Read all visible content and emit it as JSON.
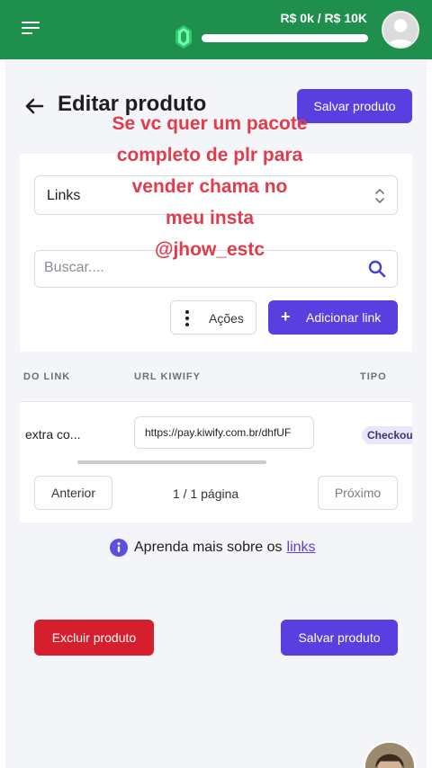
{
  "header": {
    "revenue_text": "R$ 0k / R$ 10K",
    "progress_fraction": 0.0,
    "accent_color": "#1f8f4e"
  },
  "page": {
    "title": "Editar produto",
    "save_label": "Salvar produto"
  },
  "overlay_text": [
    "Se vc quer um pacote",
    "completo de plr para",
    "vender chama no",
    "meu insta",
    "@jhow_estc"
  ],
  "links_section": {
    "selected_tab": "Links",
    "search_placeholder": "Buscar....",
    "actions_label": "Ações",
    "add_link_label": "Adicionar link",
    "columns": [
      "DO LINK",
      "URL KIWIFY",
      "TIPO"
    ],
    "rows": [
      {
        "name": "extra co...",
        "url": "https://pay.kiwify.com.br/dhfUF",
        "type": "Checkout"
      }
    ],
    "pagination": {
      "prev_label": "Anterior",
      "page_text": "1 / 1 página",
      "next_label": "Próximo"
    }
  },
  "learn_more": {
    "text": "Aprenda mais sobre os",
    "link_text": "links"
  },
  "footer": {
    "delete_label": "Excluir produto",
    "save_label": "Salvar produto"
  }
}
